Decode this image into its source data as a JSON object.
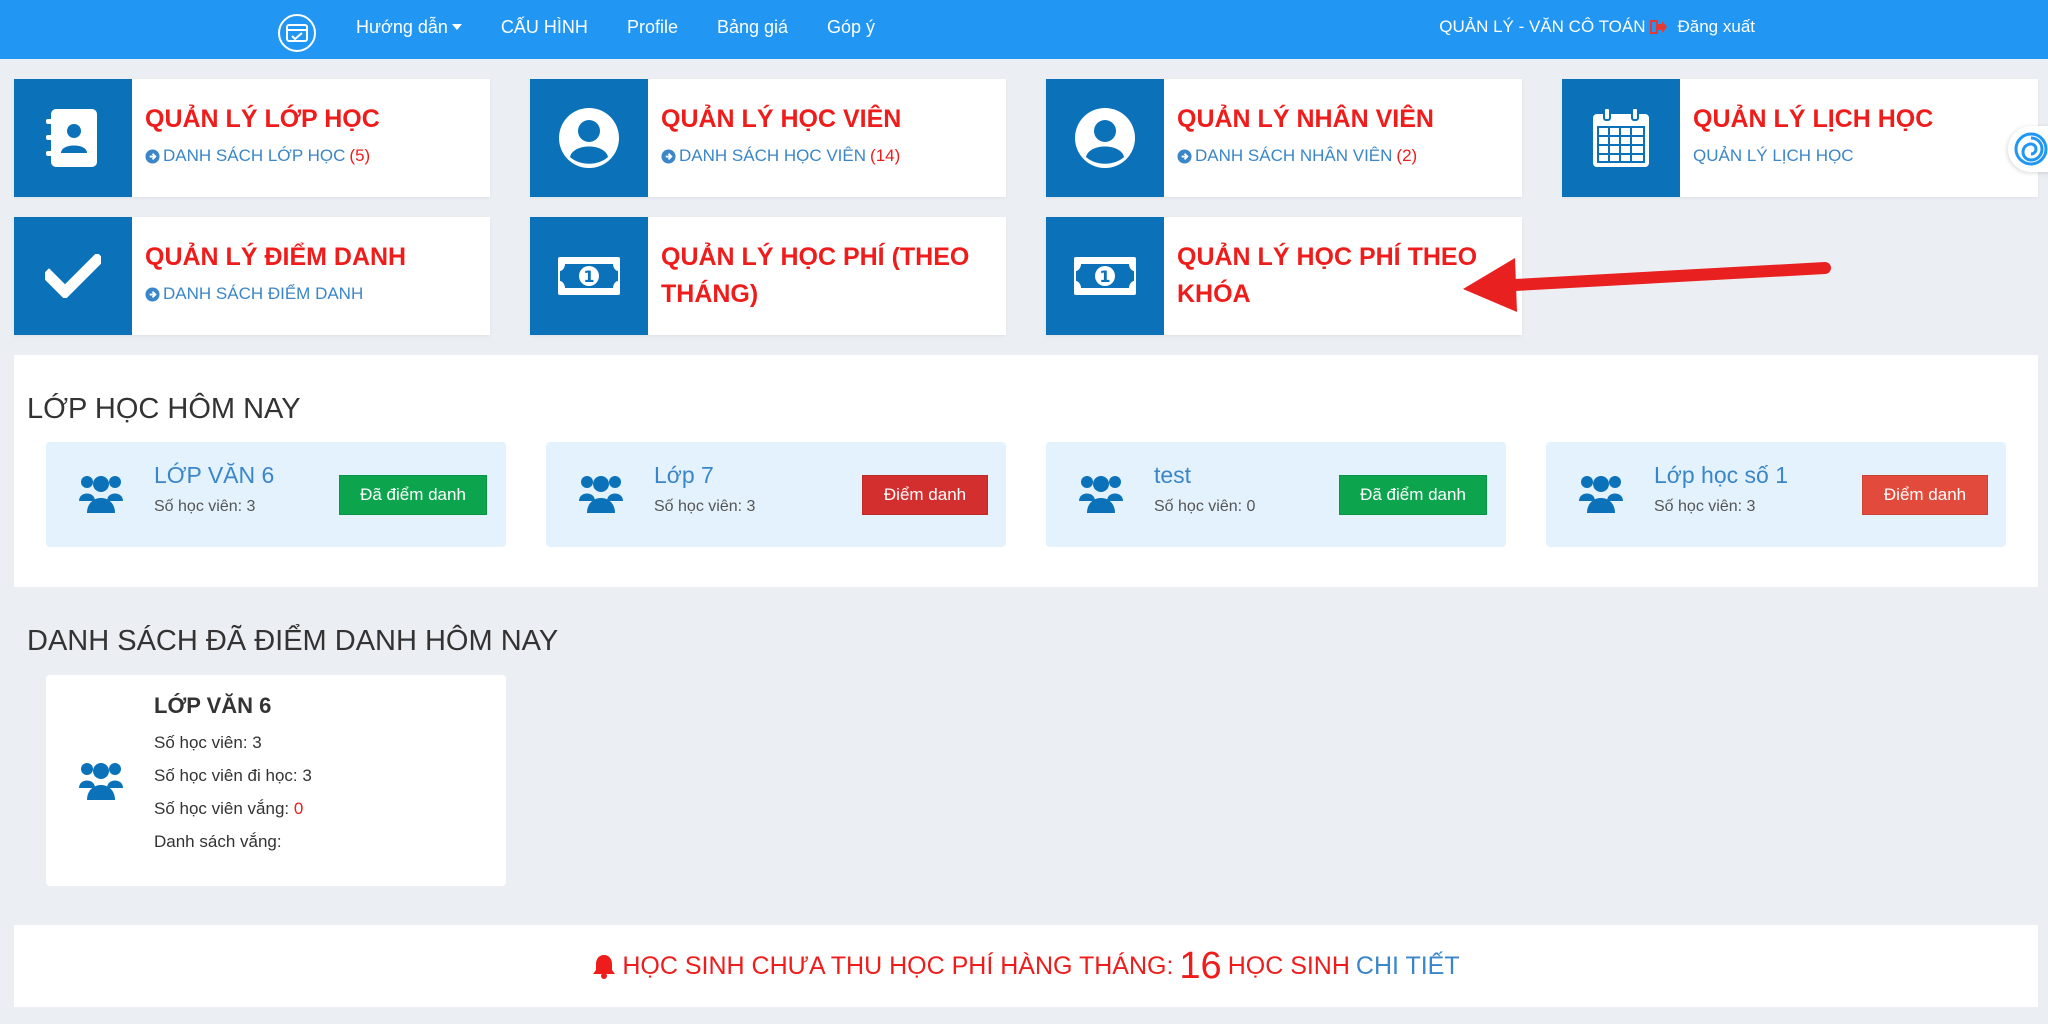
{
  "nav": {
    "links": [
      "Hướng dẫn",
      "CẤU HÌNH",
      "Profile",
      "Bảng giá",
      "Góp ý"
    ],
    "user": "QUẢN LÝ - VĂN CÔ TOÁN",
    "logout": "Đăng xuất"
  },
  "tiles": [
    {
      "title": "QUẢN LÝ LỚP HỌC",
      "link": "DANH SÁCH LỚP HỌC",
      "count": "(5)",
      "icon": "address-book-icon"
    },
    {
      "title": "QUẢN LÝ HỌC VIÊN",
      "link": "DANH SÁCH HỌC VIÊN",
      "count": "(14)",
      "icon": "user-circle-icon"
    },
    {
      "title": "QUẢN LÝ NHÂN VIÊN",
      "link": "DANH SÁCH NHÂN VIÊN",
      "count": "(2)",
      "icon": "user-circle-icon"
    },
    {
      "title": "QUẢN LÝ LỊCH HỌC",
      "link": "QUẢN LÝ LỊCH HỌC",
      "icon": "calendar-icon"
    },
    {
      "title": "QUẢN LÝ ĐIỂM DANH",
      "link": "DANH SÁCH ĐIỂM DANH",
      "icon": "checkmark-icon"
    },
    {
      "title_line1": "QUẢN LÝ HỌC PHÍ (THEO",
      "title_line2": "THÁNG)",
      "icon": "money-bill-icon"
    },
    {
      "title_line1": "QUẢN LÝ HỌC PHÍ THEO",
      "title_line2": "KHÓA",
      "icon": "money-bill-icon"
    }
  ],
  "today": {
    "title": "LỚP HỌC HÔM NAY",
    "classes": [
      {
        "name": "LỚP VĂN 6",
        "count": "Số học viên: 3",
        "button": "Đã điểm danh",
        "status": "done"
      },
      {
        "name": "Lớp 7",
        "count": "Số học viên: 3",
        "button": "Điểm danh",
        "status": "pending"
      },
      {
        "name": "test",
        "count": "Số học viên: 0",
        "button": "Đã điểm danh",
        "status": "done"
      },
      {
        "name": "Lớp học số 1",
        "count": "Số học viên: 3",
        "button": "Điểm danh",
        "status": "pending"
      }
    ]
  },
  "attended": {
    "title": "DANH SÁCH ĐÃ ĐIỂM DANH HÔM NAY",
    "card": {
      "name": "LỚP VĂN 6",
      "students": "Số học viên: 3",
      "present": "Số học viên đi học: 3",
      "absent_label": "Số học viên vắng:",
      "absent_value": "0",
      "absent_list": "Danh sách vắng:"
    }
  },
  "banner": {
    "text1": "HỌC SINH CHƯA THU HỌC PHÍ HÀNG THÁNG:",
    "count": "16",
    "text2": "HỌC SINH",
    "link": "CHI TIẾT"
  },
  "colors": {
    "navbar": "#2196f3",
    "tile_icon_bg": "#0b72b9",
    "title_red": "#ef1c1c",
    "link_blue": "#3a86c8",
    "btn_green": "#0ca54e",
    "btn_red": "#d32f2f"
  }
}
